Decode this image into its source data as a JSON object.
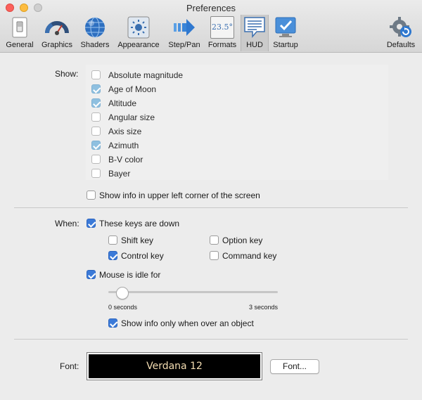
{
  "window": {
    "title": "Preferences"
  },
  "toolbar": {
    "items": [
      {
        "label": "General",
        "icon": "switch-icon"
      },
      {
        "label": "Graphics",
        "icon": "gauge-icon"
      },
      {
        "label": "Shaders",
        "icon": "globe-icon"
      },
      {
        "label": "Appearance",
        "icon": "brightness-icon"
      },
      {
        "label": "Step/Pan",
        "icon": "arrow-right-icon"
      },
      {
        "label": "Formats",
        "icon": "formats-icon",
        "icon_text": "23.5°"
      },
      {
        "label": "HUD",
        "icon": "speech-bubble-icon",
        "selected": true
      },
      {
        "label": "Startup",
        "icon": "checkmark-screen-icon"
      },
      {
        "label": "Defaults",
        "icon": "gear-reset-icon"
      }
    ]
  },
  "show": {
    "label": "Show:",
    "items": [
      {
        "label": "Absolute magnitude",
        "checked": false
      },
      {
        "label": "Age of Moon",
        "checked": true
      },
      {
        "label": "Altitude",
        "checked": true
      },
      {
        "label": "Angular size",
        "checked": false
      },
      {
        "label": "Axis size",
        "checked": false
      },
      {
        "label": "Azimuth",
        "checked": true
      },
      {
        "label": "B-V color",
        "checked": false
      },
      {
        "label": "Bayer",
        "checked": false
      }
    ],
    "upper_left": {
      "label": "Show info in upper left corner of the screen",
      "checked": false
    }
  },
  "when": {
    "label": "When:",
    "keys_down": {
      "label": "These keys are down",
      "checked": true
    },
    "shift": {
      "label": "Shift key",
      "checked": false
    },
    "option": {
      "label": "Option key",
      "checked": false
    },
    "control": {
      "label": "Control key",
      "checked": true
    },
    "command": {
      "label": "Command key",
      "checked": false
    },
    "mouse_idle": {
      "label": "Mouse is idle for",
      "checked": true
    },
    "slider": {
      "min_label": "0 seconds",
      "max_label": "3 seconds",
      "value_fraction": 0.08
    },
    "over_object": {
      "label": "Show info only when over an object",
      "checked": true
    }
  },
  "font": {
    "label": "Font:",
    "preview": "Verdana 12",
    "button": "Font..."
  },
  "colors": {
    "accent": "#3b7ad8",
    "font_preview_bg": "#000000",
    "font_preview_text": "#f5deb3"
  }
}
